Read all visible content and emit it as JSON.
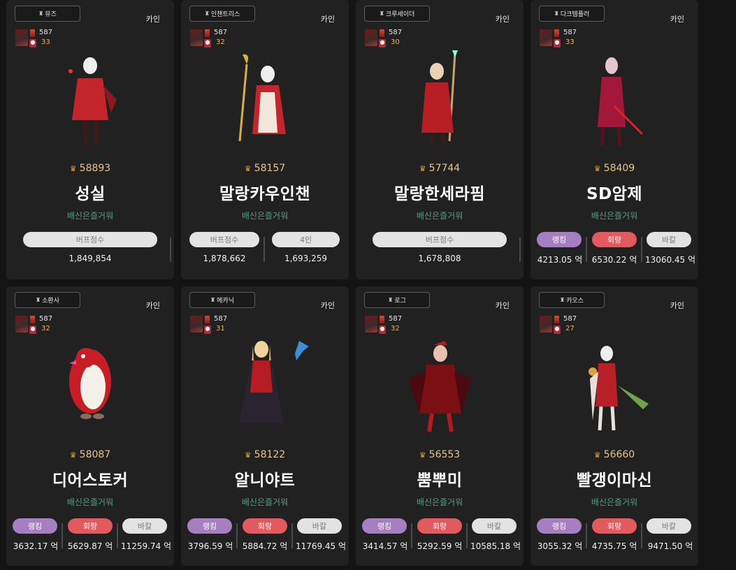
{
  "cards": [
    {
      "job": "뮤즈",
      "server": "카인",
      "level": "587",
      "sub": "33",
      "fame": "58893",
      "name": "성실",
      "guild": "배신은즐거워",
      "layout": "buff",
      "buff_label": "버프점수",
      "buff_value": "1,849,854"
    },
    {
      "job": "인챈트리스",
      "server": "카인",
      "level": "587",
      "sub": "32",
      "fame": "58157",
      "name": "말랑카우인챈",
      "guild": "배신은즐거워",
      "layout": "buff2",
      "buff_label": "버프점수",
      "buff_value": "1,878,662",
      "four_label": "4인",
      "four_value": "1,693,259"
    },
    {
      "job": "크루세이더",
      "server": "카인",
      "level": "587",
      "sub": "30",
      "fame": "57744",
      "name": "말랑한세라핌",
      "guild": "배신은즐거워",
      "layout": "buff",
      "buff_label": "버프점수",
      "buff_value": "1,678,808"
    },
    {
      "job": "다크템플러",
      "server": "카인",
      "level": "587",
      "sub": "33",
      "fame": "58409",
      "name": "SD암제",
      "guild": "배신은즐거워",
      "layout": "dps",
      "rank_label": "랭킹",
      "rank_value": "4213.05 억",
      "hoe_label": "회랑",
      "hoe_value": "6530.22 억",
      "bakal_label": "바칼",
      "bakal_value": "13060.45 억"
    },
    {
      "job": "소환사",
      "server": "카인",
      "level": "587",
      "sub": "32",
      "fame": "58087",
      "name": "디어스토커",
      "guild": "배신은즐거워",
      "layout": "dps",
      "rank_label": "랭킹",
      "rank_value": "3632.17 억",
      "hoe_label": "회랑",
      "hoe_value": "5629.87 억",
      "bakal_label": "바칼",
      "bakal_value": "11259.74 억"
    },
    {
      "job": "메카닉",
      "server": "카인",
      "level": "587",
      "sub": "31",
      "fame": "58122",
      "name": "알니야트",
      "guild": "배신은즐거워",
      "layout": "dps",
      "rank_label": "랭킹",
      "rank_value": "3796.59 억",
      "hoe_label": "회랑",
      "hoe_value": "5884.72 억",
      "bakal_label": "바칼",
      "bakal_value": "11769.45 억"
    },
    {
      "job": "로그",
      "server": "카인",
      "level": "587",
      "sub": "32",
      "fame": "56553",
      "name": "뿜뿌미",
      "guild": "배신은즐거워",
      "layout": "dps",
      "rank_label": "랭킹",
      "rank_value": "3414.57 억",
      "hoe_label": "회랑",
      "hoe_value": "5292.59 억",
      "bakal_label": "바칼",
      "bakal_value": "10585.18 억"
    },
    {
      "job": "카오스",
      "server": "카인",
      "level": "587",
      "sub": "27",
      "fame": "56660",
      "name": "빨갱이마신",
      "guild": "배신은즐거워",
      "layout": "dps",
      "rank_label": "랭킹",
      "rank_value": "3055.32 억",
      "hoe_label": "회랑",
      "hoe_value": "4735.75 억",
      "bakal_label": "바칼",
      "bakal_value": "9471.50 억"
    }
  ],
  "icons": {
    "job": "tower-icon",
    "fame": "crown-icon"
  },
  "colors": {
    "card_bg": "#212121",
    "fame": "#e9c487",
    "guild": "#4fa08a",
    "rank": "#a57fc2",
    "hoe": "#e25a5e",
    "bakal": "#e3e3e3"
  }
}
